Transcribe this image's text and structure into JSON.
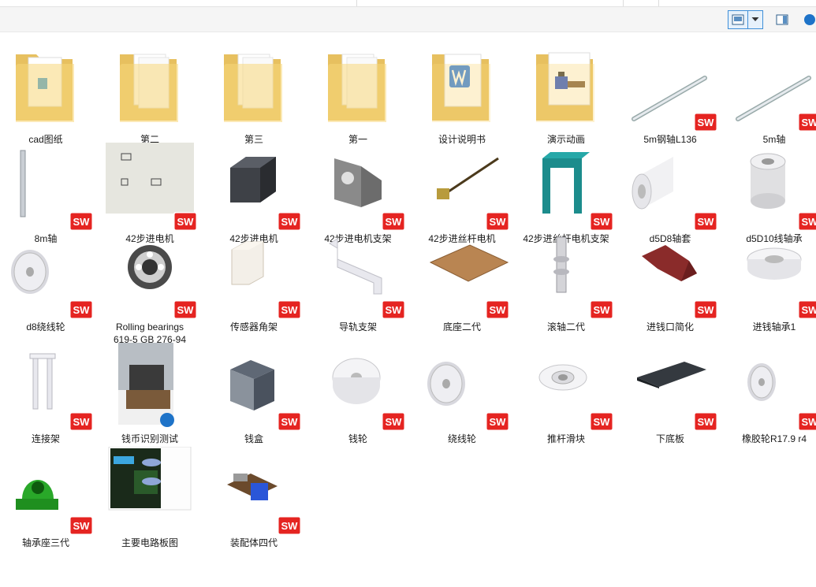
{
  "window": {
    "view_mode": "large-icons"
  },
  "toolbar": {
    "buttons": [
      {
        "name": "change-view-button",
        "icon": "large-icons-view-icon"
      },
      {
        "name": "view-options-dropdown",
        "icon": "chevron-down-icon"
      },
      {
        "name": "preview-pane-button",
        "icon": "preview-pane-icon"
      }
    ]
  },
  "files": [
    {
      "label": "cad图纸",
      "type": "folder",
      "preview": "doc-blue"
    },
    {
      "label": "第二",
      "type": "folder",
      "preview": "paper"
    },
    {
      "label": "第三",
      "type": "folder",
      "preview": "paper"
    },
    {
      "label": "第一",
      "type": "folder",
      "preview": "paper"
    },
    {
      "label": "设计说明书",
      "type": "folder",
      "preview": "word"
    },
    {
      "label": "演示动画",
      "type": "folder",
      "preview": "machine"
    },
    {
      "label": "5m钢轴L136",
      "type": "solidworks",
      "preview": "rod-diag"
    },
    {
      "label": "5m轴",
      "type": "solidworks",
      "preview": "rod-diag"
    },
    {
      "label": "8m轴",
      "type": "solidworks",
      "preview": "rod-vert"
    },
    {
      "label": "42步进电机",
      "type": "solidworks",
      "preview": "drawing"
    },
    {
      "label": "42步进电机",
      "type": "solidworks",
      "preview": "motor"
    },
    {
      "label": "42步进电机支架",
      "type": "solidworks",
      "preview": "bracket"
    },
    {
      "label": "42步进丝杆电机",
      "type": "solidworks",
      "preview": "lead-screw"
    },
    {
      "label": "42步进丝杆电机支架",
      "type": "solidworks",
      "preview": "teal-frame"
    },
    {
      "label": "d5D8轴套",
      "type": "solidworks",
      "preview": "sleeve"
    },
    {
      "label": "d5D10线轴承",
      "type": "solidworks",
      "preview": "bearing-cyl"
    },
    {
      "label": "d8绕线轮",
      "type": "solidworks",
      "preview": "pulley"
    },
    {
      "label": "Rolling bearings\n619-5 GB 276-94",
      "type": "solidworks",
      "preview": "ball-bearing"
    },
    {
      "label": "传感器角架",
      "type": "solidworks",
      "preview": "sensor-mount"
    },
    {
      "label": "导轨支架",
      "type": "solidworks",
      "preview": "rail-bracket"
    },
    {
      "label": "底座二代",
      "type": "solidworks",
      "preview": "wood-plate"
    },
    {
      "label": "滚轴二代",
      "type": "solidworks",
      "preview": "roller"
    },
    {
      "label": "进钱口简化",
      "type": "solidworks",
      "preview": "red-part"
    },
    {
      "label": "进钱轴承1",
      "type": "solidworks",
      "preview": "ring"
    },
    {
      "label": "连接架",
      "type": "solidworks",
      "preview": "link-frame"
    },
    {
      "label": "钱币识别测试",
      "type": "video",
      "preview": "photo-machine"
    },
    {
      "label": "钱盒",
      "type": "solidworks",
      "preview": "box"
    },
    {
      "label": "钱轮",
      "type": "solidworks",
      "preview": "disc"
    },
    {
      "label": "绕线轮",
      "type": "solidworks",
      "preview": "pulley"
    },
    {
      "label": "推杆滑块",
      "type": "solidworks",
      "preview": "flange"
    },
    {
      "label": "下底板",
      "type": "solidworks",
      "preview": "dark-plate"
    },
    {
      "label": "橡胶轮R17.9 r4",
      "type": "solidworks",
      "preview": "pulley-small"
    },
    {
      "label": "轴承座三代",
      "type": "solidworks",
      "preview": "pillow-block"
    },
    {
      "label": "主要电路板图",
      "type": "image",
      "preview": "circuit"
    },
    {
      "label": "装配体四代",
      "type": "solidworks",
      "preview": "assembly"
    }
  ],
  "colors": {
    "folder_back": "#e7c05f",
    "folder_front": "#f8d77a",
    "sw_red": "#e52421",
    "selection_border": "#3f8fd8",
    "toolbar_bg": "#f5f5f5"
  },
  "badge_text": "SW"
}
